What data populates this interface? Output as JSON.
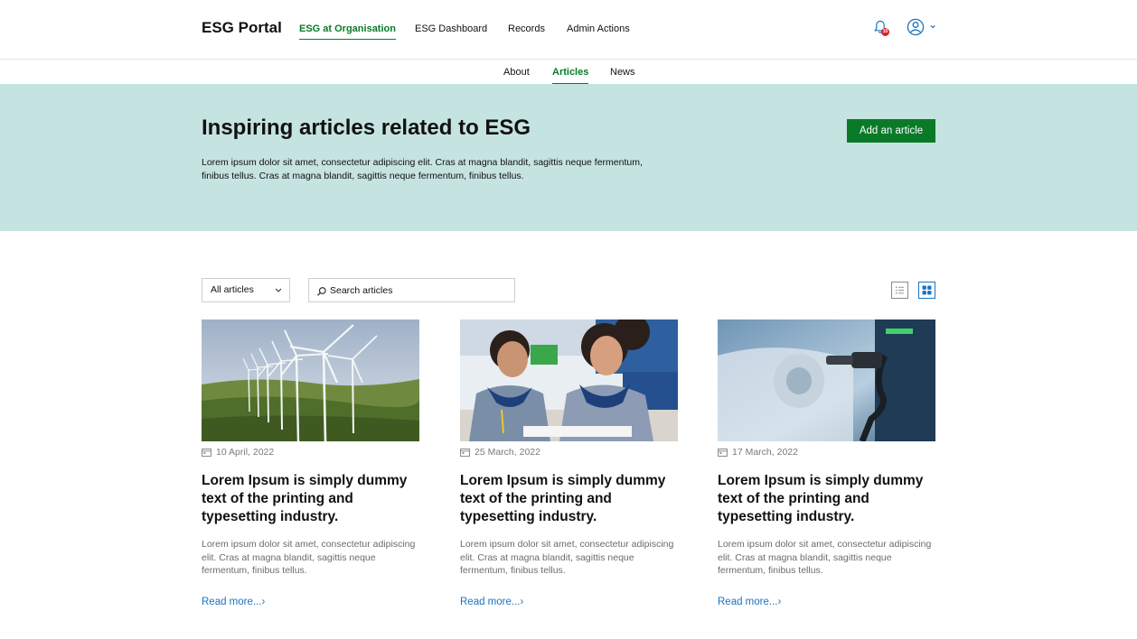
{
  "header": {
    "brand": "ESG Portal",
    "nav": [
      {
        "label": "ESG at Organisation",
        "active": true
      },
      {
        "label": "ESG Dashboard",
        "active": false
      },
      {
        "label": "Records",
        "active": false
      },
      {
        "label": "Admin Actions",
        "active": false
      }
    ],
    "notification_count": "10",
    "icons": [
      "bell-icon",
      "user-circle-icon",
      "chevron-down-icon"
    ]
  },
  "subnav": [
    {
      "label": "About",
      "active": false
    },
    {
      "label": "Articles",
      "active": true
    },
    {
      "label": "News",
      "active": false
    }
  ],
  "hero": {
    "title": "Inspiring articles related to ESG",
    "description": "Lorem ipsum dolor sit amet, consectetur adipiscing elit. Cras at magna blandit, sagittis neque fermentum, finibus tellus. Cras at magna blandit, sagittis neque fermentum, finibus tellus.",
    "add_button": "Add an article"
  },
  "filters": {
    "category_selected": "All articles",
    "search_placeholder": "Search articles",
    "view_mode": "grid"
  },
  "articles": [
    {
      "image": "wind-turbines-photo",
      "date": "10 April, 2022",
      "title": "Lorem Ipsum is simply dummy text of the printing and typesetting industry.",
      "excerpt": "Lorem ipsum dolor sit amet, consectetur adipiscing elit. Cras at magna blandit, sagittis neque fermentum, finibus tellus.",
      "link": "Read more...›"
    },
    {
      "image": "students-classroom-photo",
      "date": "25 March, 2022",
      "title": "Lorem Ipsum is simply dummy text of the printing and typesetting industry.",
      "excerpt": "Lorem ipsum dolor sit amet, consectetur adipiscing elit. Cras at magna blandit, sagittis neque fermentum, finibus tellus.",
      "link": "Read more...›"
    },
    {
      "image": "ev-charging-photo",
      "date": "17 March, 2022",
      "title": "Lorem Ipsum is simply dummy text of the printing and typesetting industry.",
      "excerpt": "Lorem ipsum dolor sit amet, consectetur adipiscing elit. Cras at magna blandit, sagittis neque fermentum, finibus tellus.",
      "link": "Read more...›"
    }
  ],
  "colors": {
    "brand_green": "#0a7a29",
    "hero_bg": "#c5e3e1",
    "link_blue": "#1a73c4",
    "badge_red": "#d8232a"
  }
}
